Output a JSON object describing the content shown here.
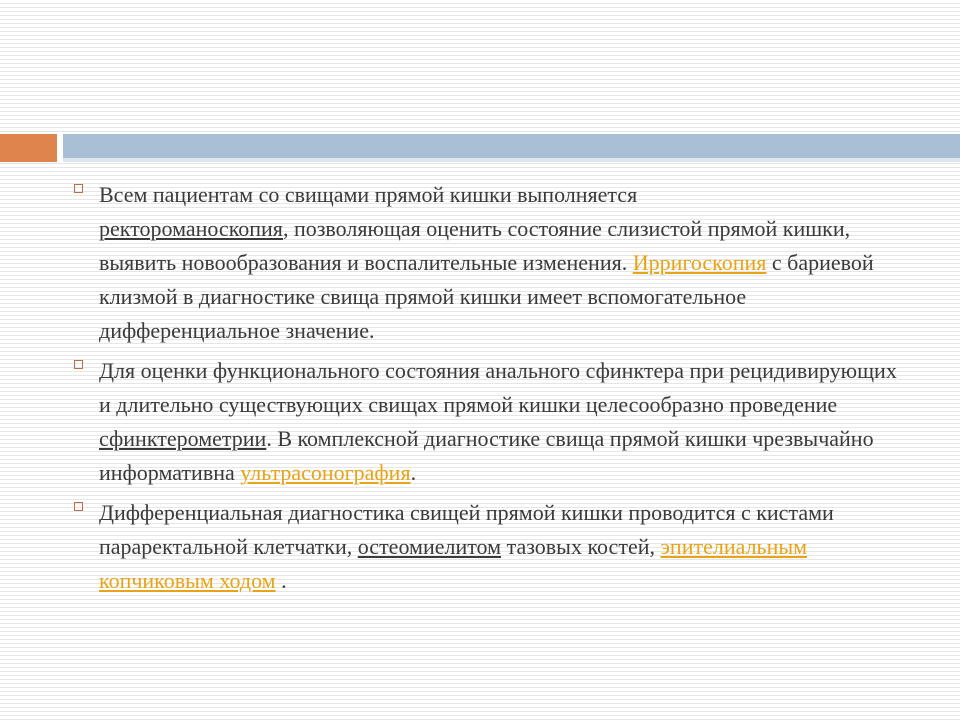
{
  "bullets": [
    {
      "s1": "Всем пациентам со свищами прямой кишки выполняется",
      "l1": "ректороманоскопия",
      "s2": ", позволяющая оценить состояние слизистой прямой кишки, выявить новообразования и воспалительные изменения. ",
      "l2": "Ирригоскопия",
      "s3": " с бариевой клизмой в диагностике свища прямой кишки имеет вспомогательное дифференциальное значение."
    },
    {
      "s1": "Для оценки функционального состояния анального сфинктера при рецидивирующих и длительно существующих свищах прямой кишки целесообразно проведение ",
      "l1": "сфинктерометрии",
      "s2": ". В комплексной диагностике свища прямой кишки чрезвычайно информативна ",
      "l2": "ультрасонография",
      "s3": "."
    },
    {
      "s1": "Дифференциальная диагностика свищей прямой кишки проводится с кистами параректальной клетчатки, ",
      "l1": "остеомиелитом",
      "s2": " тазовых костей, ",
      "l2": "эпителиальным копчиковым ходом",
      "s3": " ."
    }
  ],
  "colors": {
    "accent": "#e0844d",
    "title_bar": "#a9bfd6",
    "link": "#e8a416",
    "text": "#3a3a3a",
    "bullet_marker": "#c06e42"
  },
  "icons": {
    "bullet": "hollow-square-bullet-icon"
  }
}
